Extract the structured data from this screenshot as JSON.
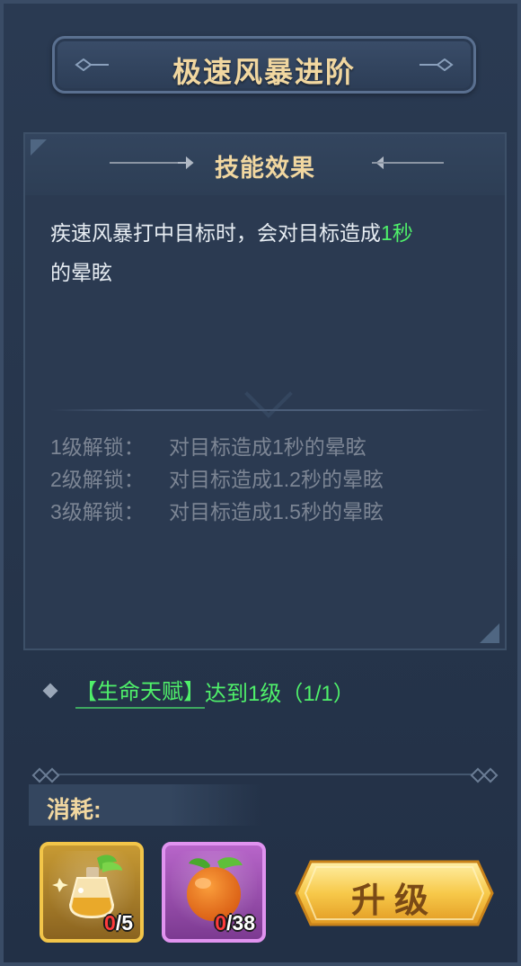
{
  "title": "极速风暴进阶",
  "effect": {
    "header": "技能效果",
    "desc_prefix": "疾速风暴打中目标时，会对目标造成",
    "desc_highlight": "1秒",
    "desc_suffix": "的晕眩",
    "unlocks": [
      {
        "level": "1级解锁：",
        "text": "对目标造成1秒的晕眩"
      },
      {
        "level": "2级解锁：",
        "text": "对目标造成1.2秒的晕眩"
      },
      {
        "level": "3级解锁：",
        "text": "对目标造成1.5秒的晕眩"
      }
    ]
  },
  "requirement": {
    "talent": "【生命天赋】",
    "rest": "达到1级（1/1）"
  },
  "cost": {
    "label": "消耗:",
    "items": [
      {
        "icon": "potion-bottle-icon",
        "have": "0",
        "need": "/5",
        "frame": "#f2c549"
      },
      {
        "icon": "orange-fruit-icon",
        "have": "0",
        "need": "/38",
        "frame": "#e093ef"
      }
    ]
  },
  "upgrade_button": {
    "label": "升级"
  },
  "colors": {
    "highlight_green": "#4ff06a",
    "title_gold": "#f1d7a0",
    "count_red": "#ff3b3b"
  }
}
